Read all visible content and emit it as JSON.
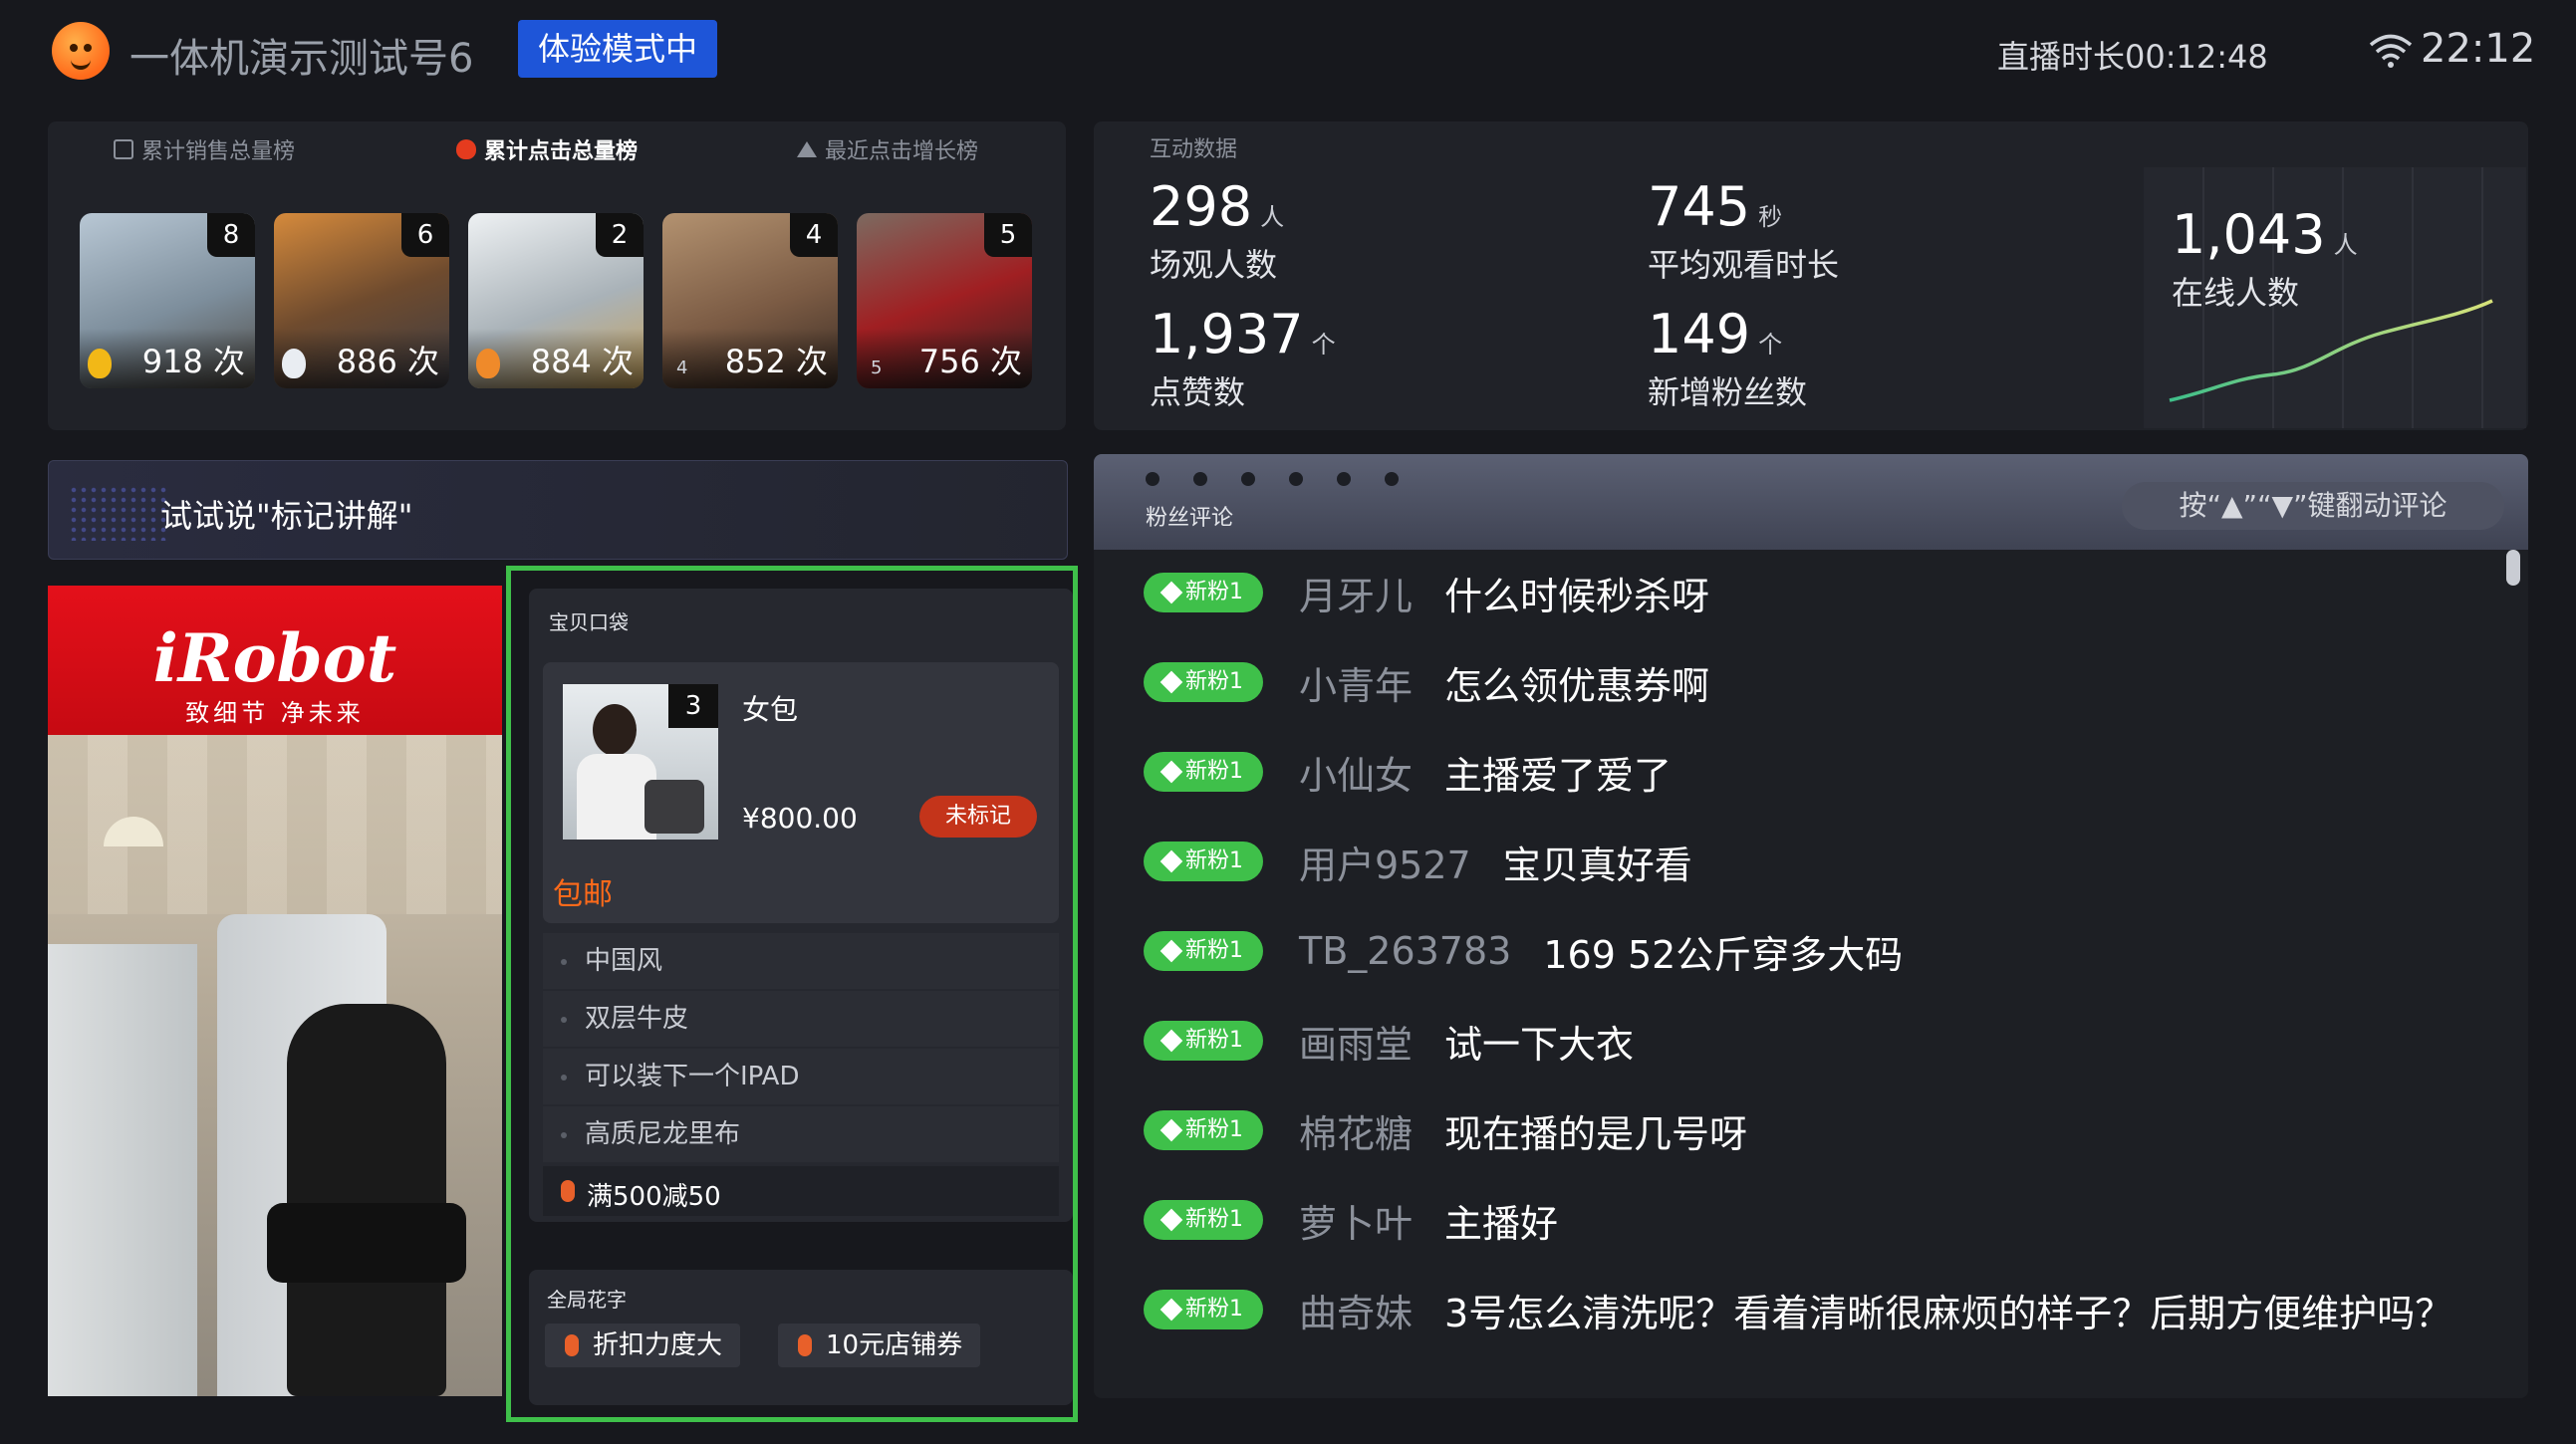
{
  "header": {
    "account_name": "一体机演示测试号6",
    "mode_badge": "体验模式中",
    "live_duration": "直播时长00:12:48",
    "clock": "22:12"
  },
  "ranking": {
    "tabs": [
      {
        "label": "累计销售总量榜",
        "active": false
      },
      {
        "label": "累计点击总量榜",
        "active": true
      },
      {
        "label": "最近点击增长榜",
        "active": false
      }
    ],
    "items": [
      {
        "rank": "8",
        "count": "918 次",
        "pos": ""
      },
      {
        "rank": "6",
        "count": "886 次",
        "pos": ""
      },
      {
        "rank": "2",
        "count": "884 次",
        "pos": ""
      },
      {
        "rank": "4",
        "count": "852 次",
        "pos": "4"
      },
      {
        "rank": "5",
        "count": "756 次",
        "pos": "5"
      }
    ]
  },
  "interaction": {
    "title": "互动数据",
    "viewers": {
      "value": "298",
      "unit": "人",
      "label": "场观人数"
    },
    "avg_watch": {
      "value": "745",
      "unit": "秒",
      "label": "平均观看时长"
    },
    "likes": {
      "value": "1,937",
      "unit": "个",
      "label": "点赞数"
    },
    "new_fans": {
      "value": "149",
      "unit": "个",
      "label": "新增粉丝数"
    },
    "online": {
      "value": "1,043",
      "unit": "人",
      "label": "在线人数"
    }
  },
  "voice_hint": "试试说\"标记讲解\"",
  "product_image": {
    "logo": "iRobot",
    "slogan": "致细节  净未来"
  },
  "pocket": {
    "title": "宝贝口袋",
    "item": {
      "rank": "3",
      "name": "女包",
      "price": "¥800.00",
      "mark_label": "未标记",
      "shipping": "包邮",
      "features": [
        "中国风",
        "双层牛皮",
        "可以装下一个IPAD",
        "高质尼龙里布"
      ],
      "promo": "满500减50"
    },
    "global_title": "全局花字",
    "global_chips": [
      "折扣力度大",
      "10元店铺券"
    ]
  },
  "comments": {
    "title": "粉丝评论",
    "flip_hint": "按“▲”“▼”键翻动评论",
    "fan_badge": "新粉1",
    "rows": [
      {
        "user": "月牙儿",
        "text": "什么时候秒杀呀"
      },
      {
        "user": "小青年",
        "text": "怎么领优惠券啊"
      },
      {
        "user": "小仙女",
        "text": "主播爱了爱了"
      },
      {
        "user": "用户9527",
        "text": "宝贝真好看"
      },
      {
        "user": "TB_263783",
        "text": "169 52公斤穿多大码"
      },
      {
        "user": "画雨堂",
        "text": "试一下大衣"
      },
      {
        "user": "棉花糖",
        "text": "现在播的是几号呀"
      },
      {
        "user": "萝卜叶",
        "text": "主播好"
      },
      {
        "user": "曲奇妹",
        "text": "3号怎么清洗呢？看着清晰很麻烦的样子？后期方便维护吗？"
      }
    ]
  },
  "colors": {
    "accent_blue": "#1e55d8",
    "highlight_green": "#3fc04a",
    "orange": "#ff6a1a",
    "badge_red": "#c4341a"
  }
}
